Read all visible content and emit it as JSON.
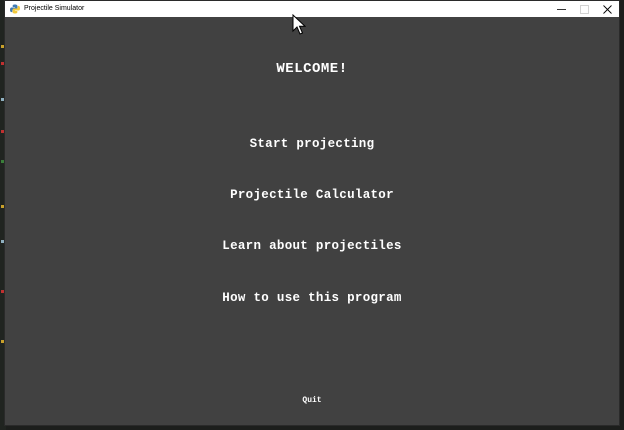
{
  "window": {
    "title": "Projectile Simulator"
  },
  "main": {
    "heading": "WELCOME!",
    "menu": [
      {
        "label": "Start projecting"
      },
      {
        "label": "Projectile Calculator"
      },
      {
        "label": "Learn about projectiles"
      },
      {
        "label": "How to use this program"
      }
    ],
    "quit_label": "Quit"
  },
  "icons": {
    "app": "python-icon",
    "minimize": "minimize-icon",
    "maximize": "maximize-icon",
    "close": "close-icon",
    "cursor": "mouse-pointer-icon"
  },
  "colors": {
    "window_bg": "#414141",
    "text": "#ffffff",
    "titlebar": "#ffffff"
  }
}
